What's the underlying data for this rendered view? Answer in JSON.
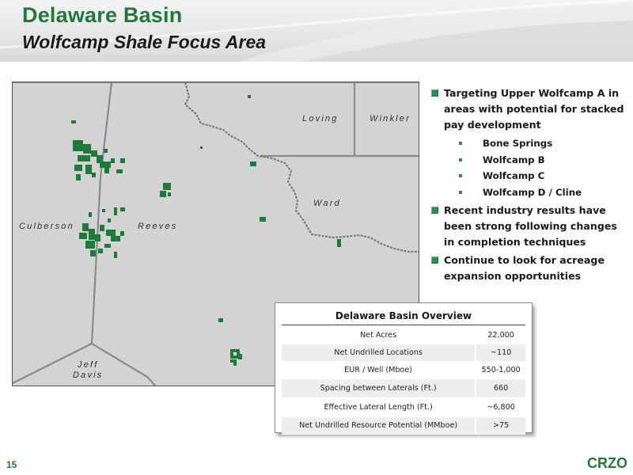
{
  "header": {
    "title": "Delaware Basin",
    "subtitle": "Wolfcamp Shale Focus Area"
  },
  "map": {
    "county_labels": {
      "loving": "Loving",
      "winkler": "Winkler",
      "ward": "Ward",
      "culberson": "Culberson",
      "reeves": "Reeves",
      "jeff": "Jeff",
      "davis": "Davis"
    },
    "colors": {
      "land": "#d3d3d3",
      "acreage": "#1f7a3a",
      "road": "#7a7a7a"
    }
  },
  "bullets": {
    "item1": "Targeting Upper Wolfcamp A in areas with potential for stacked pay development",
    "subs": [
      "Bone Springs",
      "Wolfcamp B",
      "Wolfcamp C",
      "Wolfcamp D / Cline"
    ],
    "item2": "Recent industry results have been strong following changes in completion techniques",
    "item3": "Continue to look for acreage expansion opportunities"
  },
  "overview": {
    "title": "Delaware Basin Overview",
    "rows": [
      {
        "label": "Net Acres",
        "value": "22,000"
      },
      {
        "label": "Net Undrilled Locations",
        "value": "~110"
      },
      {
        "label": "EUR / Well (Mboe)",
        "value": "550-1,000"
      },
      {
        "label": "Spacing between Laterals (Ft.)",
        "value": "660"
      },
      {
        "label": "Effective Lateral Length (Ft.)",
        "value": "~6,800"
      },
      {
        "label": "Net Undrilled Resource Potential (MMboe)",
        "value": ">75"
      }
    ]
  },
  "footer": {
    "slide_number": "15",
    "logo": "CRZO"
  }
}
